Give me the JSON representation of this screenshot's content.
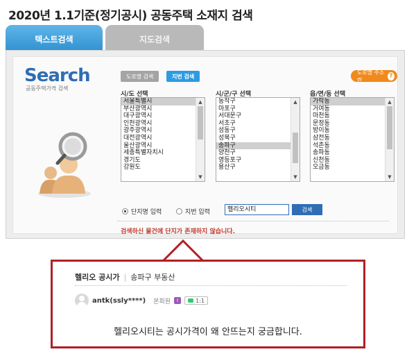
{
  "title": "2020년 1.1기준(정기공시) 공동주택 소재지 검색",
  "tabs": [
    {
      "label": "텍스트검색",
      "active": true
    },
    {
      "label": "지도검색",
      "active": false
    }
  ],
  "logo": {
    "title": "Search",
    "subtitle": "공동주택가격 검색"
  },
  "mode_buttons": {
    "road": "도로명 검색",
    "jibun": "지번 검색",
    "help": "도로명 주소란"
  },
  "columns": [
    {
      "label": "시/도 선택",
      "items": [
        "서울특별시",
        "부산광역시",
        "대구광역시",
        "인천광역시",
        "광주광역시",
        "대전광역시",
        "울산광역시",
        "세종특별자치시",
        "경기도",
        "강원도"
      ],
      "selected": 0,
      "scroll": {
        "top_fraction": 0.0,
        "size_fraction": 0.5
      }
    },
    {
      "label": "시/군/구 선택",
      "items": [
        "동작구",
        "마포구",
        "서대문구",
        "서초구",
        "성동구",
        "성북구",
        "송파구",
        "양천구",
        "영등포구",
        "용산구"
      ],
      "selected": 6,
      "scroll": {
        "top_fraction": 0.4,
        "size_fraction": 0.45
      }
    },
    {
      "label": "읍/면/동 선택",
      "items": [
        "가락동",
        "거여동",
        "마천동",
        "문정동",
        "방이동",
        "삼전동",
        "석촌동",
        "송파동",
        "신천동",
        "오금동"
      ],
      "selected": 0,
      "scroll": {
        "top_fraction": 0.0,
        "size_fraction": 0.65
      }
    }
  ],
  "radios": {
    "complex_label": "단지명 입력",
    "jibun_label": "지번 입력",
    "selected": "complex"
  },
  "search": {
    "value": "헬리오시티",
    "button": "검색"
  },
  "error": "검색하신 물건에 단지가 존재하지 않습니다.",
  "comment": {
    "title": "헬리오 공시가",
    "separator": "|",
    "source": "송파구 부동산",
    "user": "antk(ssly****)",
    "level": "본회원",
    "badge": "I",
    "chat_count": "1:1",
    "text": "헬리오시티는 공시가격이 왜 안뜨는지 궁금합니다."
  },
  "colors": {
    "accent": "#2f6db5",
    "tab_active": "#2f8fd0",
    "error": "#c0392b",
    "callout_border": "#b11f24",
    "help": "#f08a1c"
  }
}
